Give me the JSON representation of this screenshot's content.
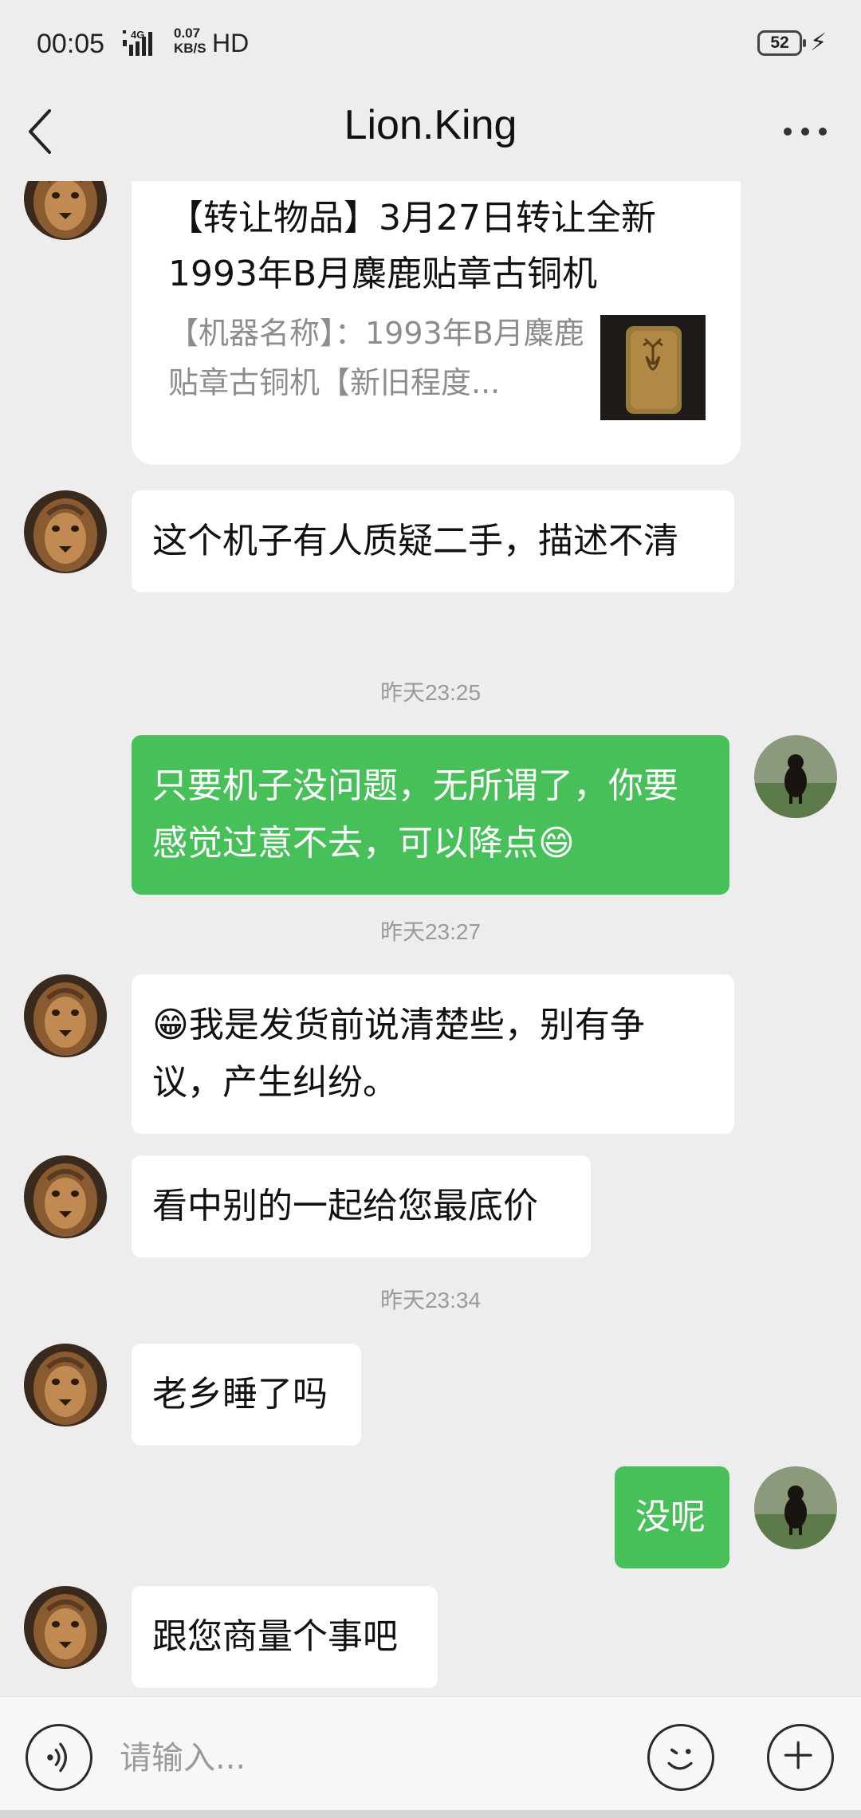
{
  "status_bar": {
    "time": "00:05",
    "net_speed_value": "0.07",
    "net_speed_unit": "KB/S",
    "hd": "HD",
    "network": "4G",
    "battery": "52"
  },
  "header": {
    "title": "Lion.King"
  },
  "card": {
    "title": "【转让物品】3月27日转让全新1993年B月麋鹿贴章古铜机",
    "description": "【机器名称】：1993年B月麋鹿贴章古铜机【新旧程度..."
  },
  "messages": [
    {
      "side": "left",
      "text": "这个机子有人质疑二手，描述不清"
    },
    {
      "timestamp": "昨天23:25"
    },
    {
      "side": "right",
      "text": "只要机子没问题，无所谓了，你要感觉过意不去，可以降点😄"
    },
    {
      "timestamp": "昨天23:27"
    },
    {
      "side": "left",
      "text": "😁我是发货前说清楚些，别有争议，产生纠纷。"
    },
    {
      "side": "left",
      "text": "看中别的一起给您最底价"
    },
    {
      "timestamp": "昨天23:34"
    },
    {
      "side": "left",
      "text": "老乡睡了吗"
    },
    {
      "side": "right",
      "text": "没呢"
    },
    {
      "side": "left",
      "text": "跟您商量个事吧"
    }
  ],
  "input": {
    "placeholder": "请输入..."
  },
  "icons": {
    "back": "back-arrow-icon",
    "more": "more-dots-icon",
    "voice": "voice-icon",
    "emoji": "emoji-icon",
    "plus": "plus-icon"
  },
  "colors": {
    "background": "#ededed",
    "own_bubble": "#48c05a",
    "other_bubble": "#ffffff",
    "timestamp": "#9a9a9a"
  }
}
